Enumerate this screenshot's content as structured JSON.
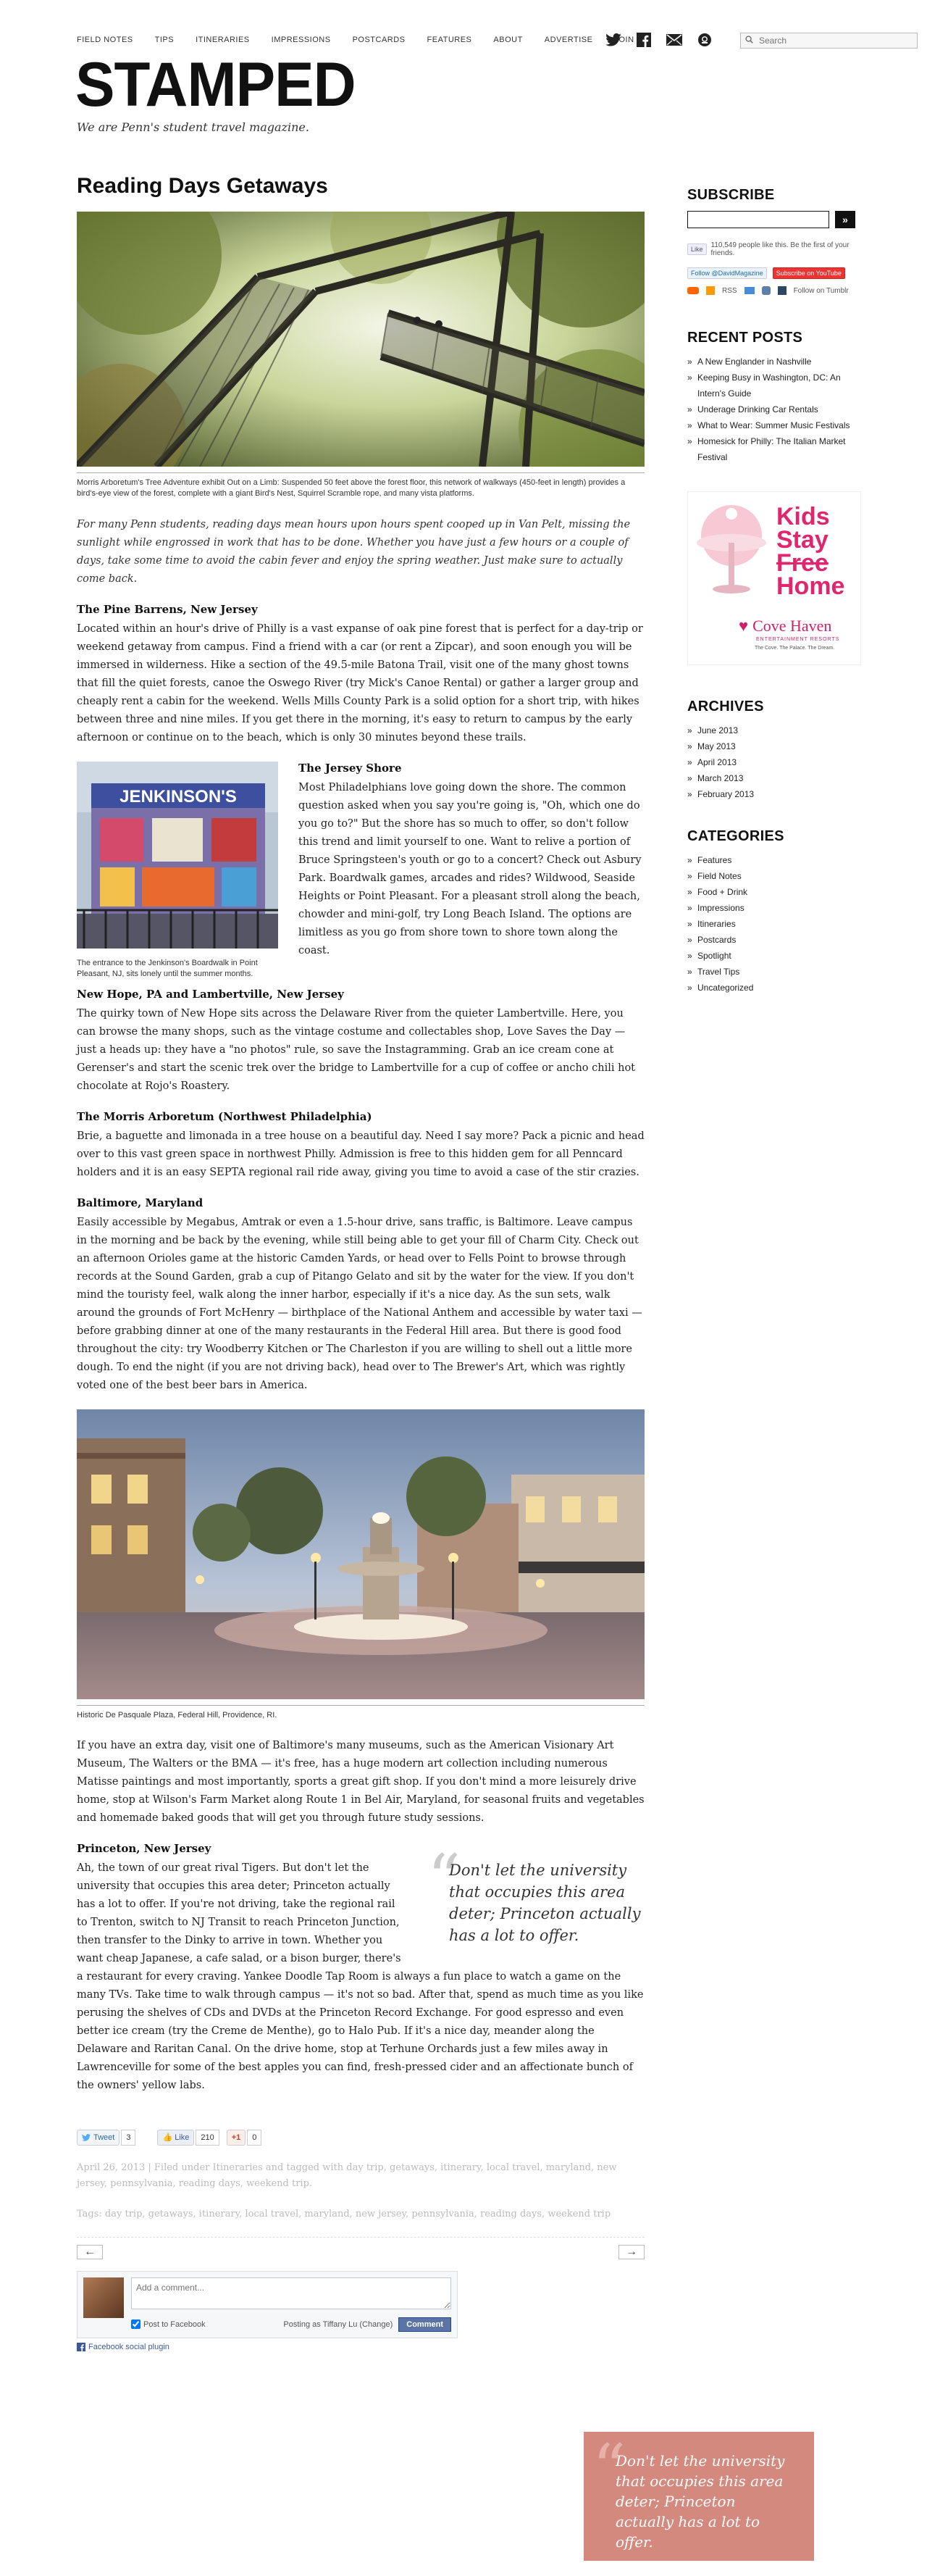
{
  "nav": {
    "links": [
      "FIELD NOTES",
      "TIPS",
      "ITINERARIES",
      "IMPRESSIONS",
      "POSTCARDS",
      "FEATURES",
      "ABOUT",
      "ADVERTISE",
      "JOIN"
    ],
    "search_placeholder": "Search"
  },
  "brand": {
    "logo": "STAMPED",
    "tagline": "We are Penn's student travel magazine."
  },
  "post": {
    "title": "Reading Days Getaways",
    "hero_caption": "Morris Arboretum's Tree Adventure exhibit Out on a Limb: Suspended 50 feet above the forest floor, this network of walkways (450-feet in length) provides a bird's-eye view of the forest, complete with a giant Bird's Nest, Squirrel Scramble rope, and many vista platforms.",
    "intro": "For many Penn students, reading days mean hours upon hours spent cooped up in Van Pelt, missing the sunlight while engrossed in work that has to be done. Whether you have just a few hours or a couple of days, take some time to avoid the cabin fever and enjoy the spring weather. Just make sure to actually come back.",
    "s1_title": "The Pine Barrens, New Jersey",
    "s1_body": "Located within an hour's drive of Philly is a vast expanse of oak pine forest that is perfect for a day-trip or weekend getaway from campus. Find a friend with a car (or rent a Zipcar), and soon enough you will be immersed in wilderness. Hike a section of the 49.5-mile Batona Trail, visit one of the many ghost towns that fill the quiet forests, canoe the Oswego River (try Mick's Canoe Rental) or gather a larger group and cheaply rent a cabin for the weekend. Wells Mills County Park is a solid option for a short trip, with hikes between three and nine miles. If you get there in the morning, it's easy to return to campus by the early afternoon or continue on to the beach, which is only 30 minutes beyond these trails.",
    "jersey_sign": "JENKINSON'S",
    "jersey_caption": "The entrance to the Jenkinson's Boardwalk in Point Pleasant, NJ, sits lonely until the summer months.",
    "s2_title": "The Jersey Shore",
    "s2_body": "Most Philadelphians love going down the shore. The common question asked when you say you're going is, \"Oh, which one do you go to?\" But the shore has so much to offer, so don't follow this trend and limit yourself to one. Want to relive a portion of Bruce Springsteen's youth or go to a concert? Check out Asbury Park. Boardwalk games, arcades and rides? Wildwood, Seaside Heights or Point Pleasant. For a pleasant stroll along the beach, chowder and mini-golf, try Long Beach Island. The options are limitless as you go from shore town to shore town along the coast.",
    "s3_title": "New Hope, PA and Lambertville, New Jersey",
    "s3_body": "The quirky town of New Hope sits across the Delaware River from the quieter Lambertville. Here, you can browse the many shops, such as the vintage costume and collectables shop, Love Saves the Day — just a heads up: they have a \"no photos\" rule, so save the Instagramming. Grab an ice cream cone at Gerenser's and start the scenic trek over the bridge to Lambertville for a cup of coffee or ancho chili hot chocolate at Rojo's Roastery.",
    "s4_title": "The Morris Arboretum (Northwest Philadelphia)",
    "s4_body": "Brie, a baguette and limonada in a tree house on a beautiful day. Need I say more? Pack a picnic and head over to this vast green space in northwest Philly. Admission is free to this hidden gem for all Penncard holders and it is an easy SEPTA regional rail ride away, giving you time to avoid a case of the stir crazies.",
    "s5_title": "Baltimore, Maryland",
    "s5_body": "Easily accessible by Megabus, Amtrak or even a 1.5-hour drive, sans traffic, is Baltimore. Leave campus in the morning and be back by the evening, while still being able to get your fill of Charm City. Check out an afternoon Orioles game at the historic Camden Yards, or head over to Fells Point to browse through records at the Sound Garden, grab a cup of Pitango Gelato and sit by the water for the view. If you don't mind the touristy feel, walk along the inner harbor, especially if it's a nice day. As the sun sets, walk around the grounds of Fort McHenry — birthplace of the National Anthem and accessible by water taxi — before grabbing dinner at one of the many restaurants in the Federal Hill area. But there is good food throughout the city: try Woodberry Kitchen or The Charleston if you are willing to shell out a little more dough. To end the night (if you are not driving back), head over to The Brewer's Art, which was rightly voted one of the best beer bars in America.",
    "plaza_caption": "Historic De Pasquale Plaza, Federal Hill, Providence, RI.",
    "s5_body2": "If you have an extra day, visit one of Baltimore's many museums, such as the American Visionary Art Museum, The Walters or the BMA — it's free, has a huge modern art collection including numerous Matisse paintings and most importantly, sports a great gift shop. If you don't mind a more leisurely drive home, stop at Wilson's Farm Market along Route 1 in Bel Air, Maryland, for seasonal fruits and vegetables and homemade baked goods that will get you through future study sessions.",
    "s6_title": "Princeton, New Jersey",
    "s6_body": "Ah, the town of our great rival Tigers. But don't let the university that occupies this area deter; Princeton actually has a lot to offer. If you're not driving, take the regional rail to Trenton, switch to NJ Transit to reach Princeton Junction, then transfer to the Dinky to arrive in town. Whether you want cheap Japanese, a cafe salad, or a bison burger, there's a restaurant for every craving. Yankee Doodle Tap Room is always a fun place to watch a game on the many TVs. Take time to walk through campus — it's not so bad. After that, spend as much time as you like perusing the shelves of CDs and DVDs at the Princeton Record Exchange. For good espresso and even better ice cream (try the Creme de Menthe), go to Halo Pub. If it's a nice day, meander along the Delaware and Raritan Canal. On the drive home, stop at Terhune Orchards just a few miles away in Lawrenceville for some of the best apples you can find, fresh-pressed cider and an affectionate bunch of the owners' yellow labs.",
    "pull_quote": "Don't let the university that occupies this area deter; Princeton actually has a lot to offer."
  },
  "share": {
    "tweet_label": "Tweet",
    "tweet_count": "3",
    "like_label": "Like",
    "like_count": "210",
    "gplus_label": "+1",
    "gplus_count": "0"
  },
  "meta": {
    "filed": "April 26, 2013 | Filed under Itineraries and tagged with day trip, getaways, itinerary, local travel, maryland, new jersey, pennsylvania, reading days, weekend trip.",
    "tags": "Tags: day trip, getaways, itinerary, local travel, maryland, new jersey, pennsylvania, reading days, weekend trip"
  },
  "pager": {
    "prev": "←",
    "next": "→"
  },
  "comments": {
    "placeholder": "Add a comment...",
    "post_to_facebook": "Post to Facebook",
    "posting_as": "Posting as Tiffany Lu (Change)",
    "button": "Comment",
    "plugin": "Facebook social plugin"
  },
  "sidebar": {
    "subscribe_title": "SUBSCRIBE",
    "fb_like_label": "Like",
    "fb_like_text": "110,549 people like this. Be the first of your friends.",
    "follow_twitter": "Follow @DavidMagazine",
    "subscribe_youtube": "Subscribe on YouTube",
    "rss_label": "RSS",
    "follow_tumblr": "Follow on Tumblr",
    "recent_title": "RECENT POSTS",
    "recent_posts": [
      "A New Englander in Nashville",
      "Keeping Busy in Washington, DC: An Intern's Guide",
      "Underage Drinking Car Rentals",
      "What to Wear: Summer Music Festivals",
      "Homesick for Philly: The Italian Market Festival"
    ],
    "ad": {
      "line1": "Kids",
      "line2": "Stay",
      "line3_strike": "Free",
      "line4": "Home",
      "brand": "Cove Haven",
      "brand_sub": "ENTERTAINMENT RESORTS",
      "tagline": "The Cove. The Palace. The Dream."
    },
    "archives_title": "ARCHIVES",
    "archives": [
      "June 2013",
      "May 2013",
      "April 2013",
      "March 2013",
      "February 2013"
    ],
    "categories_title": "CATEGORIES",
    "categories": [
      "Features",
      "Field Notes",
      "Food + Drink",
      "Impressions",
      "Itineraries",
      "Postcards",
      "Spotlight",
      "Travel Tips",
      "Uncategorized"
    ]
  },
  "colors": {
    "quote_box": "#d4897e",
    "text": "#222222",
    "twitter": "#55acee",
    "facebook": "#3b5998"
  }
}
